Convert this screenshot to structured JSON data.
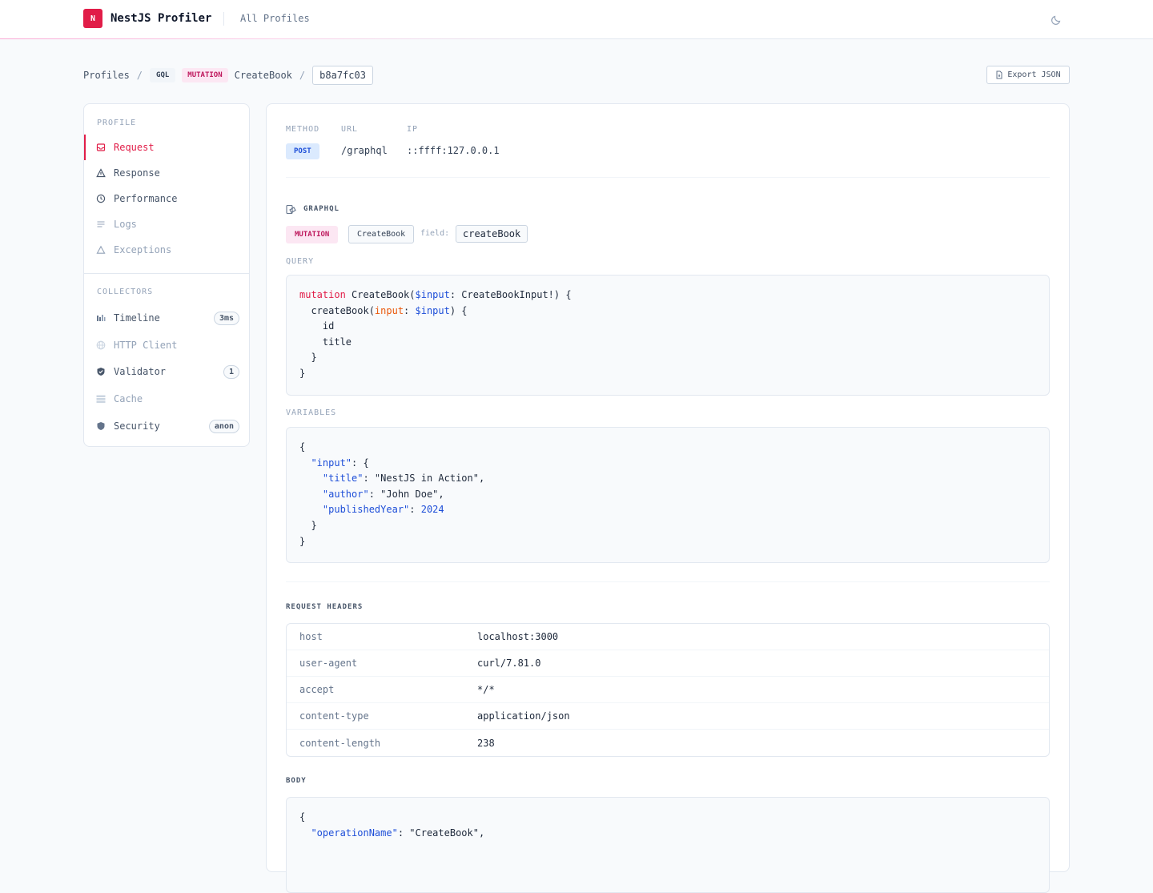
{
  "header": {
    "logo_letter": "N",
    "app_title": "NestJS Profiler",
    "all_profiles": "All Profiles",
    "theme_icon": "moon-icon"
  },
  "breadcrumb": {
    "profiles": "Profiles",
    "sep": "/",
    "type": "GQL",
    "operation_kind": "MUTATION",
    "operation_name": "CreateBook",
    "profile_id": "b8a7fc03"
  },
  "export_label": "Export JSON",
  "sidebar": {
    "profile_label": "PROFILE",
    "profile_items": [
      {
        "label": "Request",
        "icon": "inbox-icon",
        "active": true
      },
      {
        "label": "Response",
        "icon": "triangle-icon"
      },
      {
        "label": "Performance",
        "icon": "clock-icon"
      },
      {
        "label": "Logs",
        "icon": "lines-icon"
      },
      {
        "label": "Exceptions",
        "icon": "warning-icon"
      }
    ],
    "collectors_label": "COLLECTORS",
    "collector_items": [
      {
        "label": "Timeline",
        "icon": "bars-icon",
        "badge": "3ms"
      },
      {
        "label": "HTTP Client",
        "icon": "globe-icon"
      },
      {
        "label": "Validator",
        "icon": "shield-check-icon",
        "badge": "1"
      },
      {
        "label": "Cache",
        "icon": "stack-icon"
      },
      {
        "label": "Security",
        "icon": "shield-icon",
        "badge": "anon"
      }
    ]
  },
  "request": {
    "method_label": "METHOD",
    "url_label": "URL",
    "ip_label": "IP",
    "method": "POST",
    "url": "/graphql",
    "ip": "::ffff:127.0.0.1"
  },
  "graphql": {
    "title": "GRAPHQL",
    "kind": "MUTATION",
    "operation": "CreateBook",
    "field_label": "field:",
    "field": "createBook",
    "query_label": "QUERY",
    "variables_label": "VARIABLES"
  },
  "headers": {
    "title": "REQUEST HEADERS",
    "rows": [
      {
        "key": "host",
        "value": "localhost:3000"
      },
      {
        "key": "user-agent",
        "value": "curl/7.81.0"
      },
      {
        "key": "accept",
        "value": "*/*"
      },
      {
        "key": "content-type",
        "value": "application/json"
      },
      {
        "key": "content-length",
        "value": "238"
      }
    ]
  },
  "body": {
    "title": "BODY"
  },
  "colors": {
    "accent": "#e11d48",
    "post": "#1d4ed8",
    "mutation_bg": "#fce7f3"
  }
}
